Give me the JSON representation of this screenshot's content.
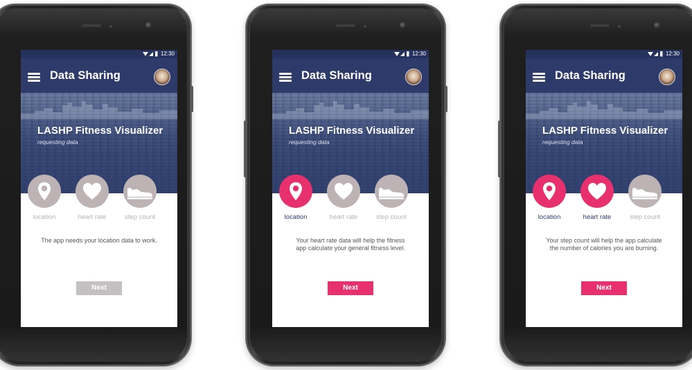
{
  "status_bar": {
    "time": "12:30"
  },
  "app_bar": {
    "title": "Data Sharing"
  },
  "hero": {
    "app_name": "LASHP Fitness Visualizer",
    "subtitle": "requesting data"
  },
  "screens": [
    {
      "permissions": [
        {
          "label": "location",
          "icon": "location-pin-icon",
          "granted": false
        },
        {
          "label": "heart rate",
          "icon": "heart-icon",
          "granted": false
        },
        {
          "label": "step count",
          "icon": "shoe-icon",
          "granted": false
        }
      ],
      "description": [
        "The app needs your location data to work."
      ],
      "next": {
        "label": "Next",
        "enabled": false
      }
    },
    {
      "permissions": [
        {
          "label": "location",
          "icon": "location-pin-icon",
          "granted": true
        },
        {
          "label": "heart rate",
          "icon": "heart-icon",
          "granted": false
        },
        {
          "label": "step count",
          "icon": "shoe-icon",
          "granted": false
        }
      ],
      "description": [
        "Your heart rate data will help the fitness",
        "app calculate your general fitness level."
      ],
      "next": {
        "label": "Next",
        "enabled": true
      }
    },
    {
      "permissions": [
        {
          "label": "location",
          "icon": "location-pin-icon",
          "granted": true
        },
        {
          "label": "heart rate",
          "icon": "heart-icon",
          "granted": true
        },
        {
          "label": "step count",
          "icon": "shoe-icon",
          "granted": false
        }
      ],
      "description": [
        "Your step count will help the app calculate",
        "the number of calories you are burning."
      ],
      "next": {
        "label": "Next",
        "enabled": true
      }
    }
  ],
  "colors": {
    "accent": "#e8306f",
    "primary": "#2e3b6a",
    "inactive": "#bdb2b4"
  }
}
